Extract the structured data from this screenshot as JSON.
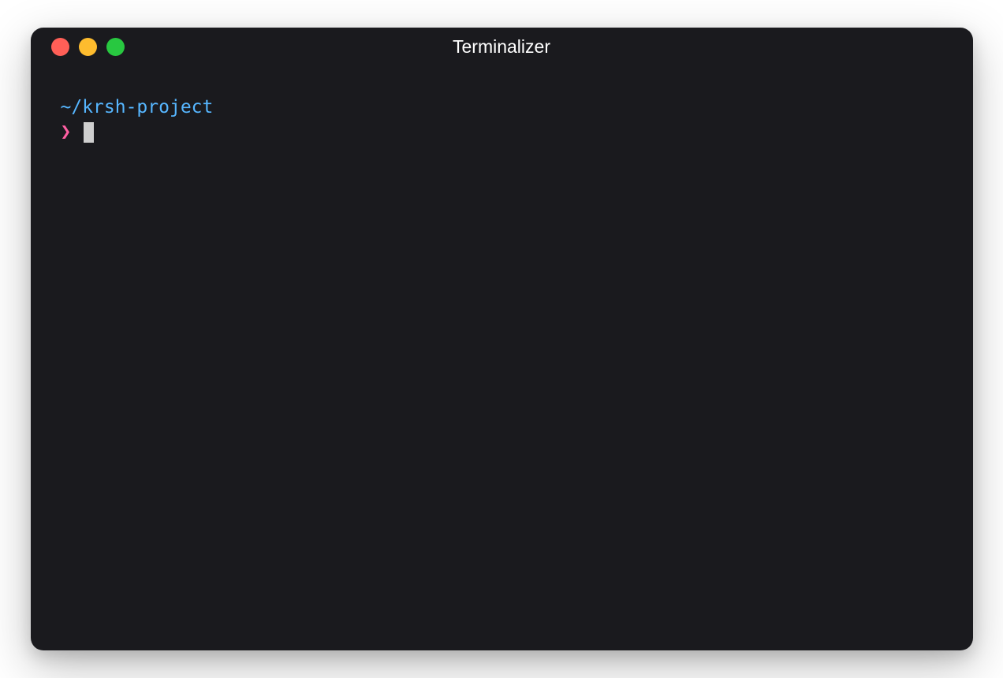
{
  "window": {
    "title": "Terminalizer"
  },
  "terminal": {
    "path": "~/krsh-project",
    "prompt_symbol": "❯",
    "command": ""
  },
  "colors": {
    "bg": "#1a1a1e",
    "close": "#ff5f57",
    "minimize": "#febc2e",
    "maximize": "#28c840",
    "path": "#56b6ff",
    "prompt": "#ff5fa3"
  }
}
